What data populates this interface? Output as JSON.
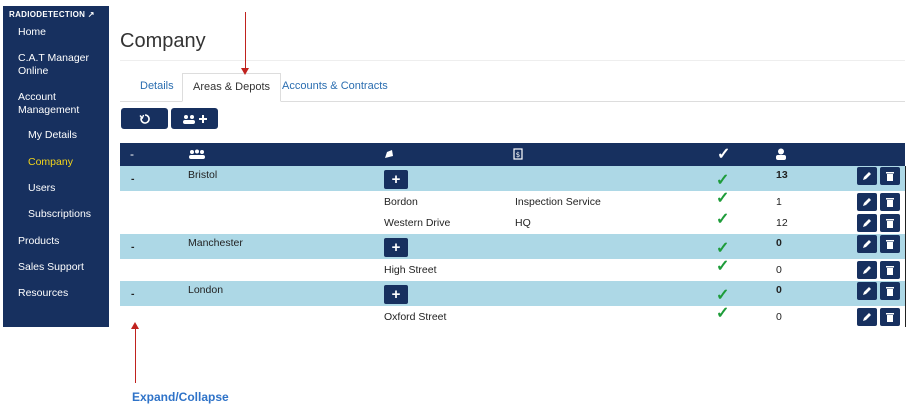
{
  "sidebar": {
    "brand": "RADIODETECTION",
    "items": [
      {
        "label": "Home",
        "sub": false,
        "active": false
      },
      {
        "label": "C.A.T Manager Online",
        "sub": false,
        "active": false
      },
      {
        "label": "Account Management",
        "sub": false,
        "active": false
      },
      {
        "label": "My Details",
        "sub": true,
        "active": false
      },
      {
        "label": "Company",
        "sub": true,
        "active": true
      },
      {
        "label": "Users",
        "sub": true,
        "active": false
      },
      {
        "label": "Subscriptions",
        "sub": true,
        "active": false
      },
      {
        "label": "Products",
        "sub": false,
        "active": false
      },
      {
        "label": "Sales Support",
        "sub": false,
        "active": false
      },
      {
        "label": "Resources",
        "sub": false,
        "active": false
      }
    ]
  },
  "page": {
    "title": "Company"
  },
  "tabs": [
    {
      "label": "Details",
      "active": false
    },
    {
      "label": "Areas & Depots",
      "active": true
    },
    {
      "label": "Accounts & Contracts",
      "active": false
    }
  ],
  "table": {
    "collapse_symbol": "-",
    "groups": [
      {
        "area": "Bristol",
        "checked": true,
        "users": "13",
        "depots": [
          {
            "name": "Bordon",
            "contract": "Inspection Service",
            "checked": true,
            "users": "1"
          },
          {
            "name": "Western Drive",
            "contract": "HQ",
            "checked": true,
            "users": "12"
          }
        ]
      },
      {
        "area": "Manchester",
        "checked": true,
        "users": "0",
        "depots": [
          {
            "name": "High Street",
            "contract": "",
            "checked": true,
            "users": "0"
          }
        ]
      },
      {
        "area": "London",
        "checked": true,
        "users": "0",
        "depots": [
          {
            "name": "Oxford Street",
            "contract": "",
            "checked": true,
            "users": "0"
          }
        ]
      }
    ]
  },
  "annotation": {
    "text": "Expand/Collapse"
  },
  "colors": {
    "navy": "#17305f",
    "group_row": "#add8e6",
    "active_nav": "#f2d41b",
    "check": "#1e9c3a",
    "arrow": "#c0221e",
    "annotation": "#2f73c8"
  }
}
